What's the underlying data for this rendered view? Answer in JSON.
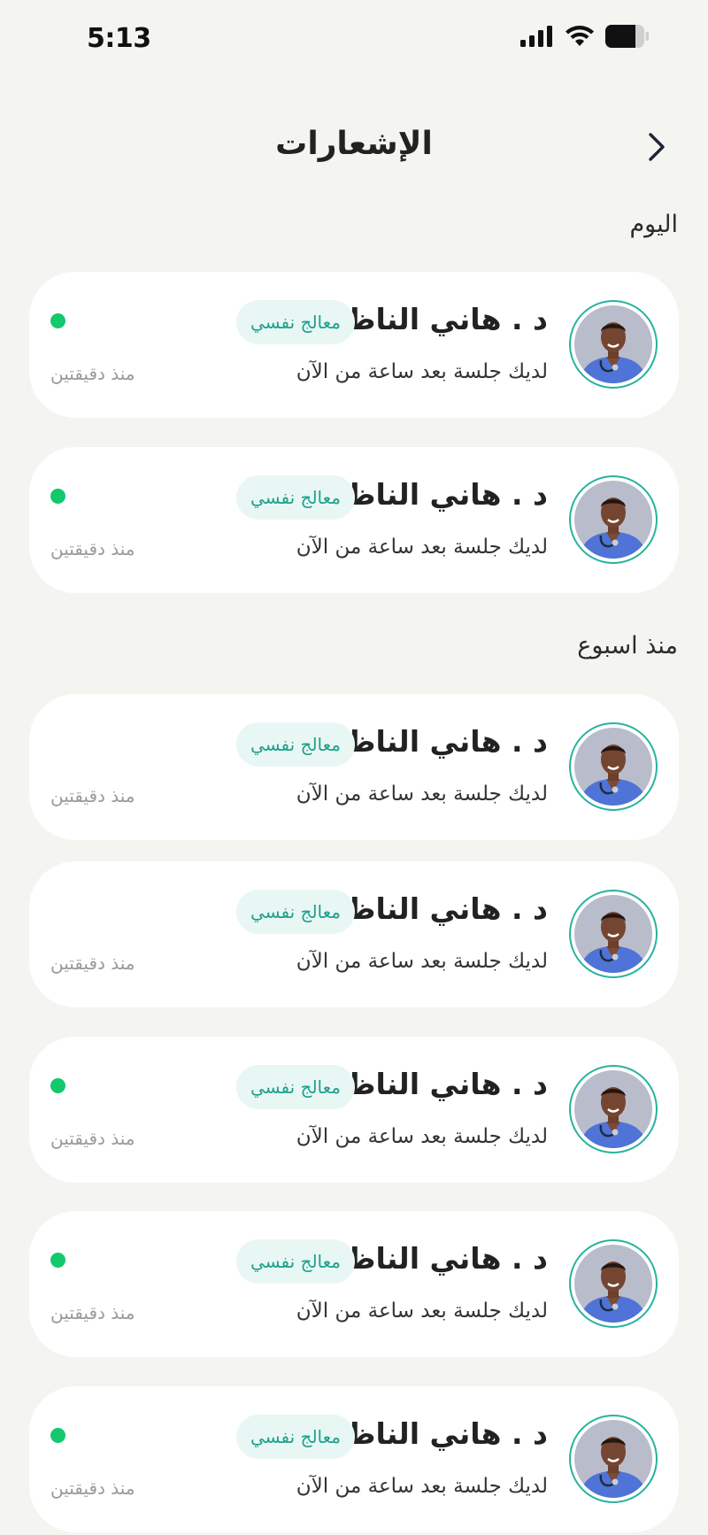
{
  "status_bar": {
    "time": "5:13"
  },
  "header": {
    "title": "الإشعارات"
  },
  "sections": [
    {
      "title": "اليوم"
    },
    {
      "title": "منذ اسبوع"
    }
  ],
  "notifications": [
    {
      "name": "د . هاني الناظر",
      "role": "معالج نفسي",
      "message": "لديك جلسة بعد ساعة من الآن",
      "time": "منذ دقيقتين",
      "unread": true
    },
    {
      "name": "د . هاني الناظر",
      "role": "معالج نفسي",
      "message": "لديك جلسة بعد ساعة من الآن",
      "time": "منذ دقيقتين",
      "unread": true
    },
    {
      "name": "د . هاني الناظر",
      "role": "معالج نفسي",
      "message": "لديك جلسة بعد ساعة من الآن",
      "time": "منذ دقيقتين",
      "unread": false
    },
    {
      "name": "د . هاني الناظر",
      "role": "معالج نفسي",
      "message": "لديك جلسة بعد ساعة من الآن",
      "time": "منذ دقيقتين",
      "unread": false
    },
    {
      "name": "د . هاني الناظر",
      "role": "معالج نفسي",
      "message": "لديك جلسة بعد ساعة من الآن",
      "time": "منذ دقيقتين",
      "unread": true
    },
    {
      "name": "د . هاني الناظر",
      "role": "معالج نفسي",
      "message": "لديك جلسة بعد ساعة من الآن",
      "time": "منذ دقيقتين",
      "unread": true
    },
    {
      "name": "د . هاني الناظر",
      "role": "معالج نفسي",
      "message": "لديك جلسة بعد ساعة من الآن",
      "time": "منذ دقيقتين",
      "unread": true
    }
  ],
  "colors": {
    "accent": "#1fa08e",
    "unread_dot": "#13c86d",
    "background": "#f4f4f1"
  },
  "icons": {
    "back": "chevron-right-icon",
    "signal": "signal-icon",
    "wifi": "wifi-icon",
    "battery": "battery-icon"
  }
}
